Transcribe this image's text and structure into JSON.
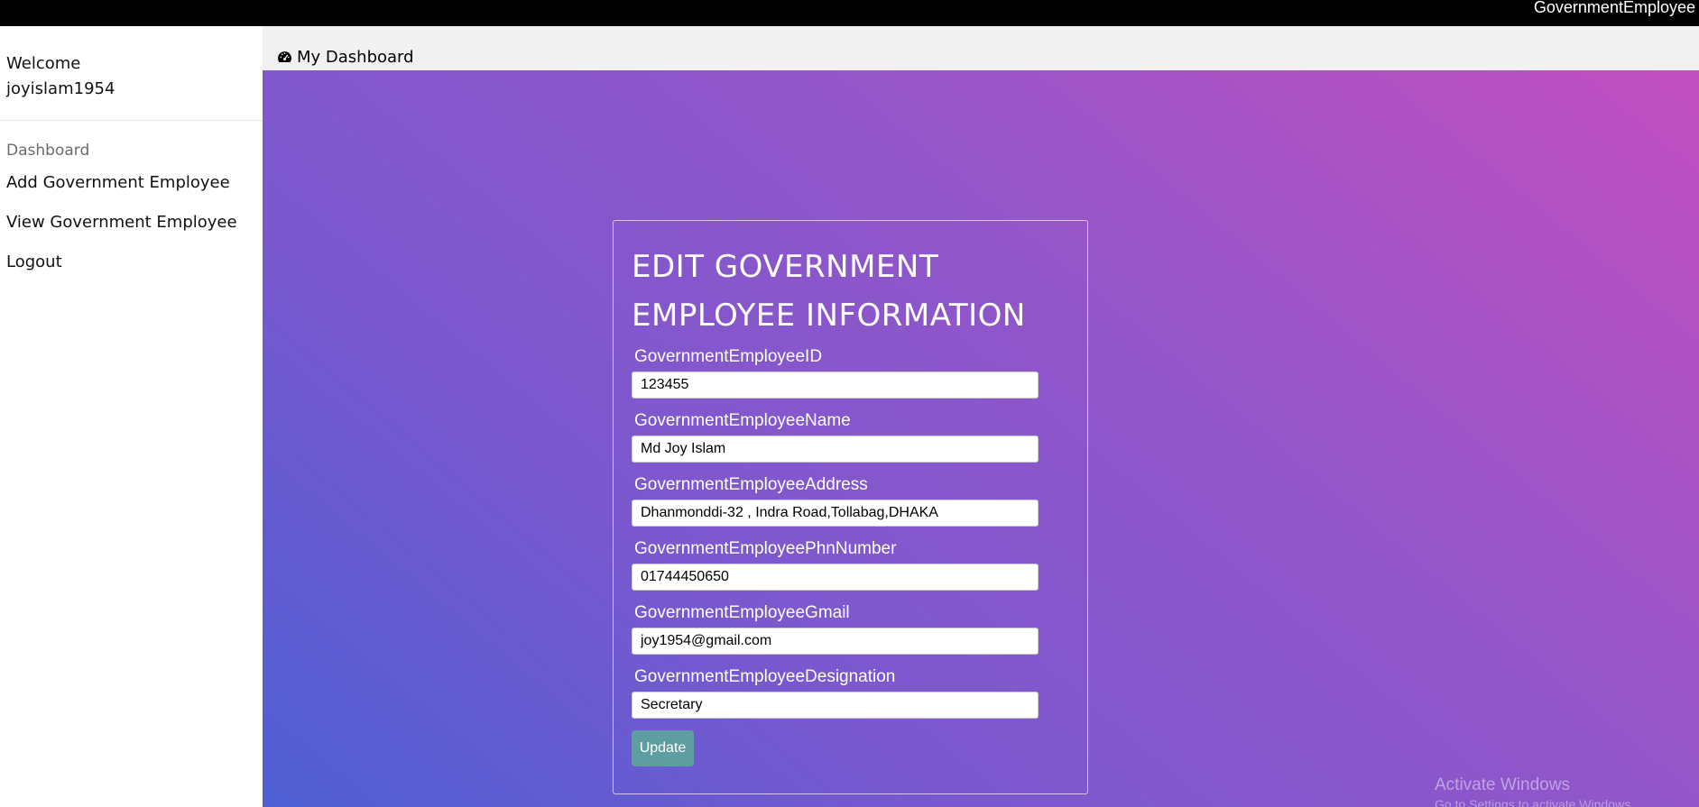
{
  "topbar": {
    "brand": "GovernmentEmployee"
  },
  "sidebar": {
    "welcome": "Welcome",
    "username": "joyislam1954",
    "heading": "Dashboard",
    "links": [
      {
        "label": "Add Government Employee"
      },
      {
        "label": "View Government Employee"
      },
      {
        "label": "Logout"
      }
    ]
  },
  "dashbar": {
    "icon": "dashboard-icon",
    "title": "My Dashboard"
  },
  "form": {
    "title": "EDIT GOVERNMENT EMPLOYEE INFORMATION",
    "fields": [
      {
        "label": "GovernmentEmployeeID",
        "value": "123455"
      },
      {
        "label": "GovernmentEmployeeName",
        "value": "Md Joy Islam"
      },
      {
        "label": "GovernmentEmployeeAddress",
        "value": "Dhanmonddi-32 , Indra Road,Tollabag,DHAKA"
      },
      {
        "label": "GovernmentEmployeePhnNumber",
        "value": "01744450650"
      },
      {
        "label": "GovernmentEmployeeGmail",
        "value": "joy1954@gmail.com"
      },
      {
        "label": "GovernmentEmployeeDesignation",
        "value": "Secretary"
      }
    ],
    "submit_label": "Update"
  },
  "watermark": {
    "title": "Activate Windows",
    "subtitle": "Go to Settings to activate Windows."
  },
  "colors": {
    "topbar": "#000000",
    "button": "#5f9ea0",
    "gradient_start": "#4d5fd3",
    "gradient_end": "#c64fc0"
  }
}
